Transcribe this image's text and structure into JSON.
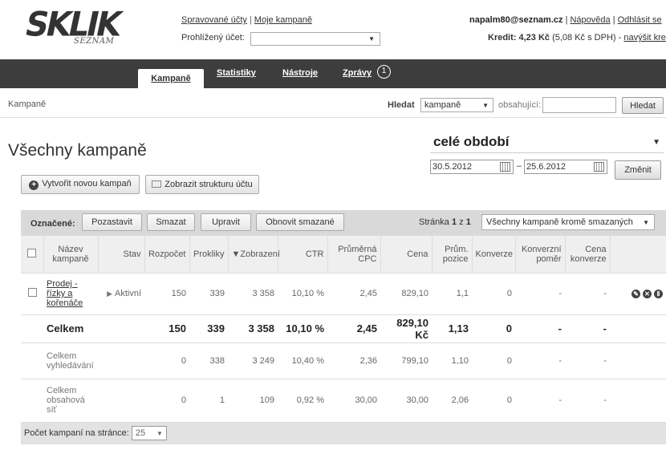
{
  "logo": {
    "main": "SKLIK",
    "sub": "SEZNAM"
  },
  "topnav": {
    "managed_accounts": "Spravované účty",
    "separator": "|",
    "my_campaigns": "Moje kampaně"
  },
  "viewed_account": {
    "label": "Prohlížený účet:",
    "value": ""
  },
  "user": {
    "email": "napalm80@seznam.cz",
    "separator": "|",
    "help": "Nápověda",
    "logout": "Odhlásit se"
  },
  "credit": {
    "label": "Kredit: 4,23 Kč",
    "vat": "(5,08 Kč s DPH) -",
    "topup": "navýšit kredit"
  },
  "nav": {
    "tabs": [
      {
        "label": "Kampaně",
        "active": true
      },
      {
        "label": "Statistiky"
      },
      {
        "label": "Nástroje"
      },
      {
        "label": "Zprávy"
      }
    ],
    "messages_count": "1"
  },
  "breadcrumb": "Kampaně",
  "search": {
    "label": "Hledat",
    "scope": "kampaně",
    "contains_label": "obsahující:",
    "query": "",
    "button": "Hledat"
  },
  "page_title": "Všechny kampaně",
  "period": {
    "selected": "celé období",
    "from": "30.5.2012",
    "dash": "–",
    "to": "25.6.2012",
    "change_button": "Změnit"
  },
  "actions": {
    "new_campaign": "Vytvořit novou kampaň",
    "show_structure": "Zobrazit strukturu účtu"
  },
  "toolbar": {
    "marked_label": "Označené:",
    "pause": "Pozastavit",
    "delete": "Smazat",
    "edit": "Upravit",
    "restore": "Obnovit smazané",
    "page_prefix": "Stránka",
    "page_current": "1",
    "page_of": "z",
    "page_total": "1",
    "filter": "Všechny kampaně kromě smazaných"
  },
  "columns": {
    "name": "Název kampaně",
    "status": "Stav",
    "budget": "Rozpočet",
    "clicks": "Prokliky",
    "impressions": "Zobrazení",
    "ctr": "CTR",
    "avg_cpc": "Průměrná CPC",
    "cost": "Cena",
    "avg_pos": "Prům. pozice",
    "conversions": "Konverze",
    "conv_rate": "Konverzní poměr",
    "conv_cost": "Cena konverze"
  },
  "rows": [
    {
      "name": "Prodej - řízky a kořenáče",
      "status": "Aktivní",
      "budget": "150",
      "clicks": "339",
      "impressions": "3 358",
      "ctr": "10,10 %",
      "avg_cpc": "2,45",
      "cost": "829,10",
      "avg_pos": "1,1",
      "conversions": "0",
      "conv_rate": "-",
      "conv_cost": "-"
    }
  ],
  "total": {
    "name": "Celkem",
    "budget": "150",
    "clicks": "339",
    "impressions": "3 358",
    "ctr": "10,10 %",
    "avg_cpc": "2,45",
    "cost": "829,10 Kč",
    "avg_pos": "1,13",
    "conversions": "0",
    "conv_rate": "-",
    "conv_cost": "-"
  },
  "search_total": {
    "name": "Celkem vyhledávání",
    "budget": "0",
    "clicks": "338",
    "impressions": "3 249",
    "ctr": "10,40 %",
    "avg_cpc": "2,36",
    "cost": "799,10",
    "avg_pos": "1,10",
    "conversions": "0",
    "conv_rate": "-",
    "conv_cost": "-"
  },
  "content_total": {
    "name": "Celkem obsahová síť",
    "budget": "0",
    "clicks": "1",
    "impressions": "109",
    "ctr": "0,92 %",
    "avg_cpc": "30,00",
    "cost": "30,00",
    "avg_pos": "2,06",
    "conversions": "0",
    "conv_rate": "-",
    "conv_cost": "-"
  },
  "footer": {
    "per_page_label": "Počet kampaní na stránce:",
    "per_page": "25"
  },
  "icons": [
    "plus-circle-icon",
    "folder-icon",
    "edit-icon",
    "delete-icon",
    "pause-icon",
    "calendar-icon",
    "sort-arrow-icon"
  ]
}
